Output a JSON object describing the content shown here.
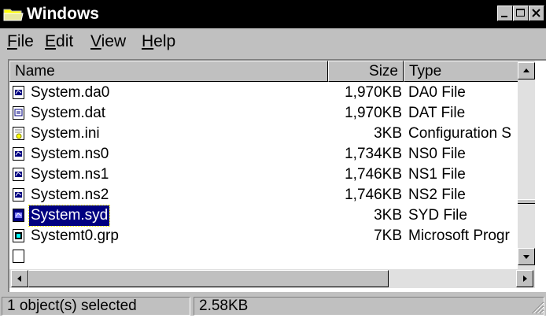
{
  "window": {
    "title": "Windows",
    "icon": "folder-icon",
    "title_bg": "#000000",
    "controls": [
      "minimize-icon",
      "maximize-icon",
      "close-icon"
    ]
  },
  "menu": {
    "items": [
      {
        "accel": "F",
        "rest": "ile"
      },
      {
        "accel": "E",
        "rest": "dit"
      },
      {
        "accel": "V",
        "rest": "iew"
      },
      {
        "accel": "H",
        "rest": "elp"
      }
    ]
  },
  "list": {
    "columns": [
      "Name",
      "Size",
      "Type"
    ],
    "rows": [
      {
        "name": "System.da0",
        "size": "1,970KB",
        "type": "DA0 File",
        "icon": "system-file-icon",
        "selected": false
      },
      {
        "name": "System.dat",
        "size": "1,970KB",
        "type": "DAT File",
        "icon": "dat-file-icon",
        "selected": false
      },
      {
        "name": "System.ini",
        "size": "3KB",
        "type": "Configuration S",
        "icon": "config-file-icon",
        "selected": false
      },
      {
        "name": "System.ns0",
        "size": "1,734KB",
        "type": "NS0 File",
        "icon": "system-file-icon",
        "selected": false
      },
      {
        "name": "System.ns1",
        "size": "1,746KB",
        "type": "NS1 File",
        "icon": "system-file-icon",
        "selected": false
      },
      {
        "name": "System.ns2",
        "size": "1,746KB",
        "type": "NS2 File",
        "icon": "system-file-icon",
        "selected": false
      },
      {
        "name": "System.syd",
        "size": "3KB",
        "type": "SYD File",
        "icon": "system-file-icon",
        "selected": true
      },
      {
        "name": "Systemt0.grp",
        "size": "7KB",
        "type": "Microsoft Progr",
        "icon": "program-group-icon",
        "selected": false
      },
      {
        "name": "",
        "size": "",
        "type": "",
        "icon": "file-icon",
        "selected": false
      }
    ]
  },
  "status": {
    "selection": "1 object(s) selected",
    "size": "2.58KB"
  },
  "colors": {
    "face": "#c0c0c0",
    "selection": "#000080"
  }
}
